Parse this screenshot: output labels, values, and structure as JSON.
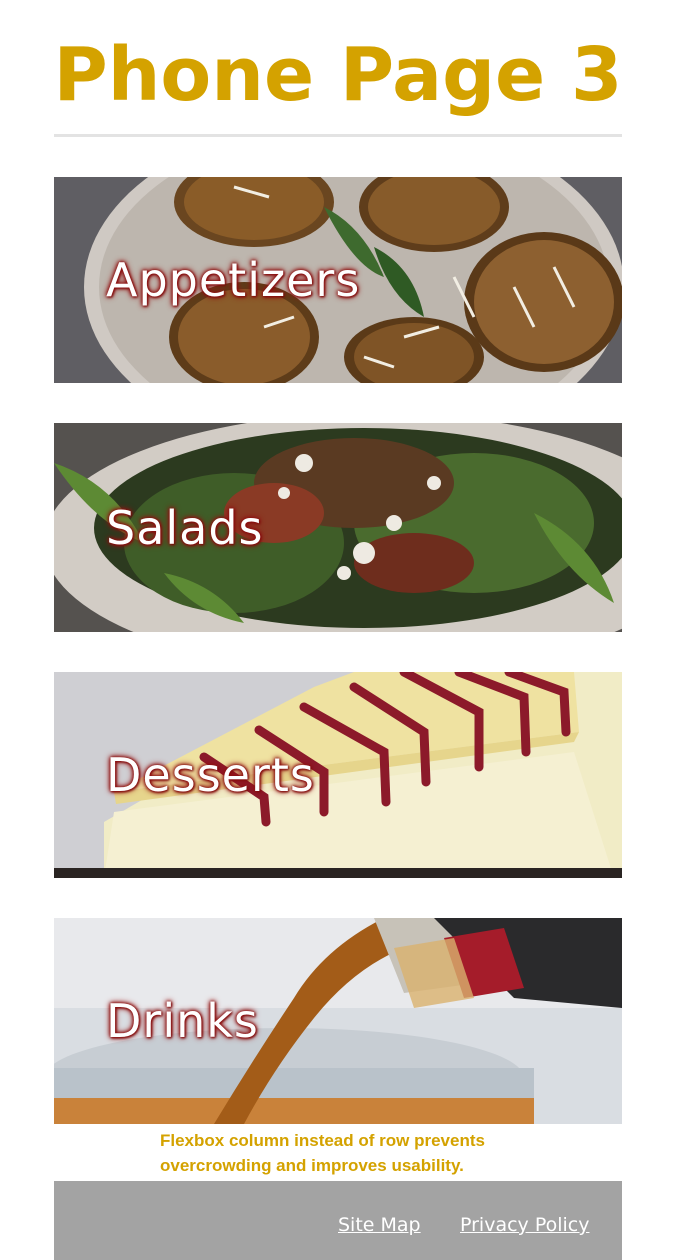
{
  "header": {
    "title": "Phone Page 3"
  },
  "menu": {
    "items": [
      {
        "label": "Appetizers"
      },
      {
        "label": "Salads"
      },
      {
        "label": "Desserts"
      },
      {
        "label": "Drinks"
      }
    ]
  },
  "caption": "Flexbox column instead of row prevents overcrowding and improves usability.",
  "footer": {
    "links": [
      {
        "label": "Site Map"
      },
      {
        "label": "Privacy Policy"
      }
    ]
  },
  "colors": {
    "title": "#d4a200",
    "footer_bg": "#a3a3a3",
    "label_glow": "#8b1010"
  }
}
